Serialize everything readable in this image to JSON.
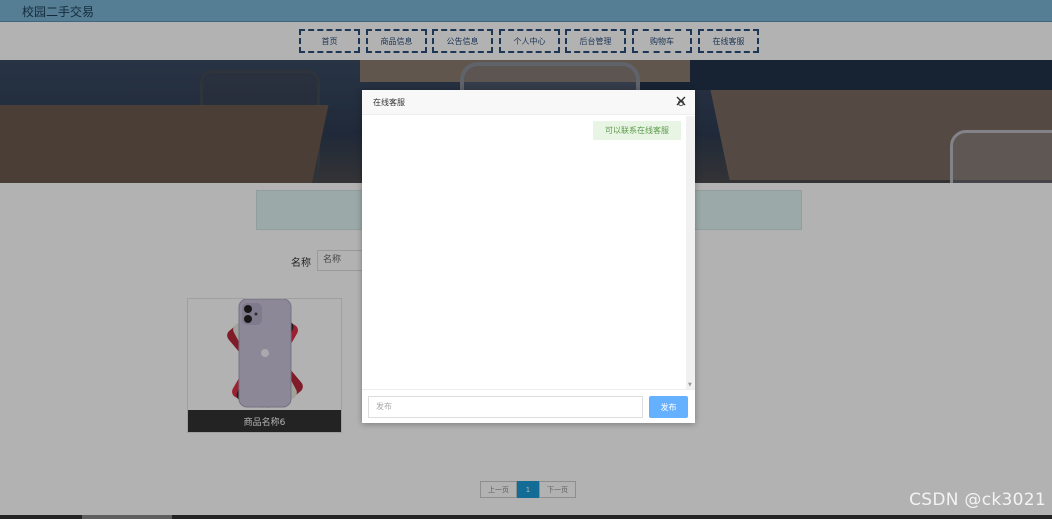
{
  "app": {
    "title": "校园二手交易"
  },
  "nav": {
    "items": [
      {
        "label": "首页"
      },
      {
        "label": "商品信息"
      },
      {
        "label": "公告信息"
      },
      {
        "label": "个人中心"
      },
      {
        "label": "后台管理"
      },
      {
        "label": "购物车"
      },
      {
        "label": "在线客服"
      }
    ]
  },
  "search": {
    "label": "名称",
    "placeholder": "名称"
  },
  "products": [
    {
      "name": "商品名称6"
    }
  ],
  "pagination": {
    "prev": "上一页",
    "current": "1",
    "next": "下一页"
  },
  "chat_dialog": {
    "title": "在线客服",
    "close_icon": "close-icon",
    "messages": [
      {
        "text": "可以联系在线客服",
        "side": "right"
      }
    ],
    "input_placeholder": "发布",
    "send_label": "发布"
  },
  "colors": {
    "topbar": "#7ab3d3",
    "nav_border": "#2a4e7c",
    "send_button": "#66b1ff",
    "pager_active": "#1a9bd7",
    "message_bubble": "#e8f4e4"
  },
  "watermark": "CSDN @ck3021"
}
